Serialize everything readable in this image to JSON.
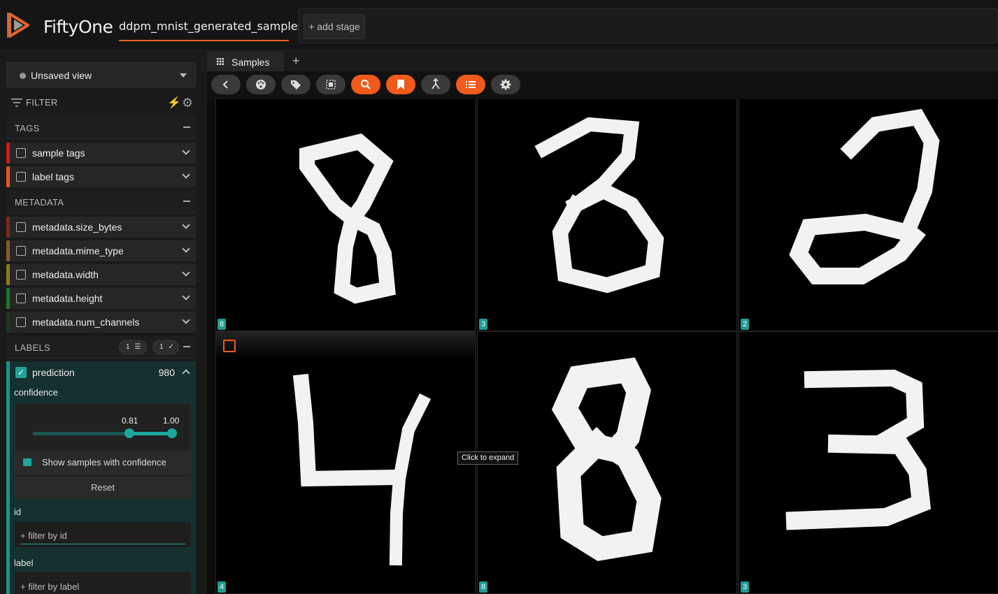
{
  "app": {
    "brand": "FiftyOne",
    "dataset_name": "ddpm_mnist_generated_samples",
    "add_stage": "+ add stage",
    "accent": "#f05a1a"
  },
  "sidebar": {
    "view_select": "Unsaved view",
    "filter_label": "FILTER",
    "sections": {
      "tags": "TAGS",
      "metadata": "METADATA",
      "labels": "LABELS"
    },
    "tag_fields": [
      {
        "name": "sample tags",
        "color": "#d11c1c"
      },
      {
        "name": "label tags",
        "color": "#e8551f"
      }
    ],
    "metadata_fields": [
      {
        "name": "metadata.size_bytes",
        "color": "#7b2a17"
      },
      {
        "name": "metadata.mime_type",
        "color": "#8b5a2b"
      },
      {
        "name": "metadata.width",
        "color": "#8a7c1c"
      },
      {
        "name": "metadata.height",
        "color": "#1d7a28"
      },
      {
        "name": "metadata.num_channels",
        "color": "#1a3a20"
      }
    ],
    "labels_pills": {
      "filter_count": "1",
      "visible_count": "1"
    },
    "prediction": {
      "name": "prediction",
      "count": "980",
      "checked": true,
      "confidence_label": "confidence",
      "confidence_min": "0.81",
      "confidence_max": "1.00",
      "show_samples": "Show samples with confidence",
      "reset": "Reset",
      "id_label": "id",
      "id_placeholder": "+ filter by id",
      "label_label": "label",
      "label_placeholder": "+ filter by label"
    }
  },
  "main": {
    "tab": "Samples",
    "add_tab": "+",
    "toolbar": [
      {
        "icon": "back-icon",
        "active": false
      },
      {
        "icon": "palette-icon",
        "active": false
      },
      {
        "icon": "tag-icon",
        "active": false
      },
      {
        "icon": "select-icon",
        "active": false
      },
      {
        "icon": "search-icon",
        "active": true
      },
      {
        "icon": "bookmark-icon",
        "active": true
      },
      {
        "icon": "merge-icon",
        "active": false
      },
      {
        "icon": "list-icon",
        "active": true
      },
      {
        "icon": "gear-icon",
        "active": false
      }
    ],
    "samples": [
      {
        "label": "8"
      },
      {
        "label": "3"
      },
      {
        "label": "2"
      },
      {
        "label": "4"
      },
      {
        "label": "8"
      },
      {
        "label": "3"
      }
    ],
    "tooltip": "Click to expand"
  }
}
